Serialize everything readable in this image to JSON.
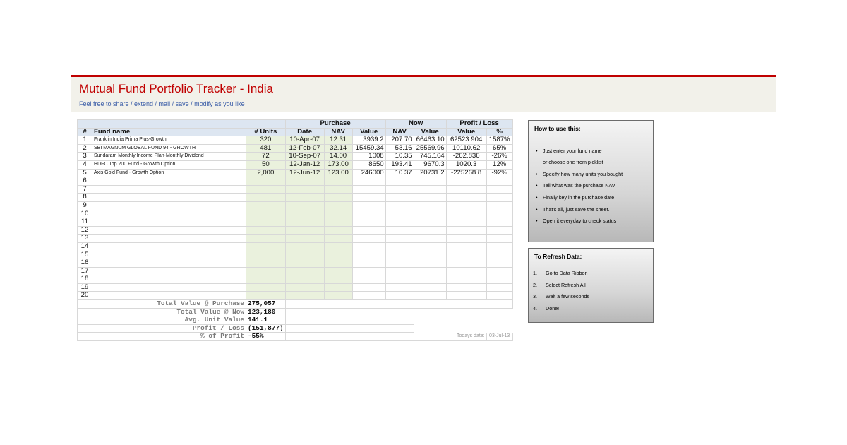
{
  "header": {
    "title": "Mutual Fund Portfolio Tracker - India",
    "subtitle": "Feel free to share / extend / mail / save / modify as you like"
  },
  "table": {
    "group_headers": {
      "purchase": "Purchase",
      "now": "Now",
      "profit_loss": "Profit / Loss"
    },
    "columns": [
      "#",
      "Fund name",
      "# Units",
      "Date",
      "NAV",
      "Value",
      "NAV",
      "Value",
      "Value",
      "%"
    ],
    "rows": [
      {
        "idx": "1",
        "fund": "Franklin India Prima Plus-Growth",
        "units": "320",
        "date": "10-Apr-07",
        "nav": "12.31",
        "value": "3939.2",
        "now_nav": "207.70",
        "now_value": "66463.10",
        "pl_value": "62523.904",
        "pl_pct": "1587%"
      },
      {
        "idx": "2",
        "fund": "SBI MAGNUM GLOBAL FUND 94 - GROWTH",
        "units": "481",
        "date": "12-Feb-07",
        "nav": "32.14",
        "value": "15459.34",
        "now_nav": "53.16",
        "now_value": "25569.96",
        "pl_value": "10110.62",
        "pl_pct": "65%"
      },
      {
        "idx": "3",
        "fund": "Sundaram Monthly Income Plan-Monthly Dividend",
        "units": "72",
        "date": "10-Sep-07",
        "nav": "14.00",
        "value": "1008",
        "now_nav": "10.35",
        "now_value": "745.164",
        "pl_value": "-262.836",
        "pl_pct": "-26%"
      },
      {
        "idx": "4",
        "fund": "HDFC Top 200 Fund - Growth Option",
        "units": "50",
        "date": "12-Jan-12",
        "nav": "173.00",
        "value": "8650",
        "now_nav": "193.41",
        "now_value": "9670.3",
        "pl_value": "1020.3",
        "pl_pct": "12%"
      },
      {
        "idx": "5",
        "fund": "Axis Gold Fund - Growth Option",
        "units": "2,000",
        "date": "12-Jun-12",
        "nav": "123.00",
        "value": "246000",
        "now_nav": "10.37",
        "now_value": "20731.2",
        "pl_value": "-225268.8",
        "pl_pct": "-92%"
      },
      {
        "idx": "6"
      },
      {
        "idx": "7"
      },
      {
        "idx": "8"
      },
      {
        "idx": "9"
      },
      {
        "idx": "10"
      },
      {
        "idx": "11"
      },
      {
        "idx": "12"
      },
      {
        "idx": "13"
      },
      {
        "idx": "14"
      },
      {
        "idx": "15"
      },
      {
        "idx": "16"
      },
      {
        "idx": "17"
      },
      {
        "idx": "18"
      },
      {
        "idx": "19"
      },
      {
        "idx": "20"
      }
    ]
  },
  "summary": [
    {
      "label": "Total Value @ Purchase",
      "value": "275,057"
    },
    {
      "label": "Total Value @ Now",
      "value": "123,180"
    },
    {
      "label": "Avg. Unit Value",
      "value": "141.1"
    },
    {
      "label": "Profit / Loss",
      "value": "(151,877)"
    },
    {
      "label": "% of Profit",
      "value": "-55%"
    }
  ],
  "today": {
    "label": "Todays date:",
    "value": "03-Jul-13"
  },
  "how_to": {
    "title": "How to use this:",
    "items": [
      "Just enter your fund name",
      "or choose one from picklist",
      "Specify how many units you bought",
      "Tell what was the purchase NAV",
      "Finally key in the purchase date",
      "That's all, just save the sheet.",
      "Open it everyday to check status"
    ]
  },
  "refresh": {
    "title": "To Refresh Data:",
    "items": [
      "Go to Data Ribbon",
      "Select Refresh All",
      "Wait a few seconds",
      "Done!"
    ]
  },
  "colors": {
    "accent": "#c00000",
    "header_fill": "#dde6f1",
    "input_fill": "#eaf1dd",
    "link": "#3c5ea8"
  }
}
